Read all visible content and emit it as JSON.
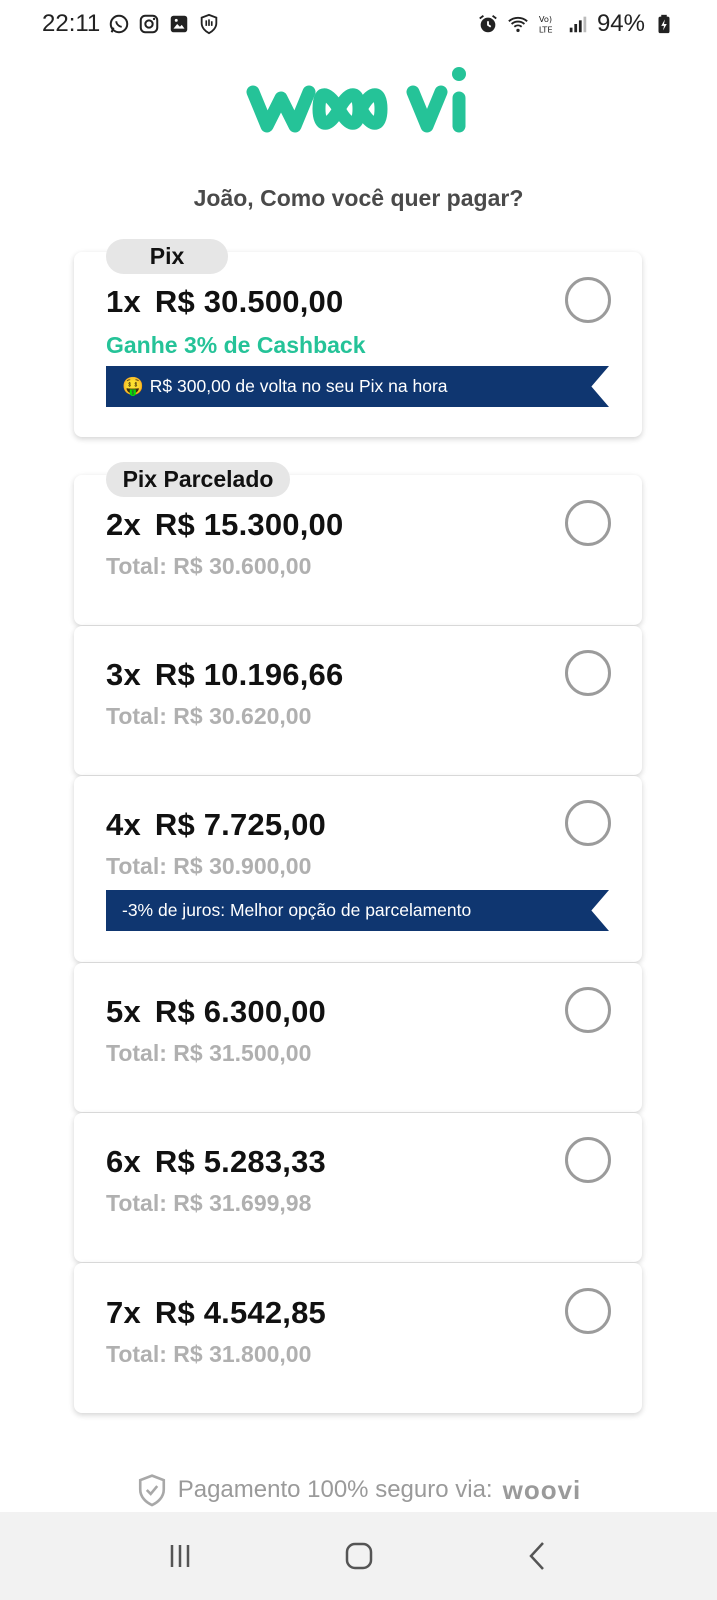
{
  "status": {
    "time": "22:11",
    "battery": "94%",
    "left_icons": [
      "whatsapp-icon",
      "instagram-icon",
      "gallery-icon",
      "shield-hand-icon"
    ],
    "right_icons": [
      "alarm-icon",
      "wifi-icon",
      "volte-icon",
      "signal-icon",
      "battery-icon"
    ]
  },
  "brand": {
    "name": "woovi",
    "color": "#25c398"
  },
  "prompt": "João, Como você quer pagar?",
  "pix": {
    "chip_label": "Pix",
    "multiplier": "1x",
    "amount": "R$ 30.500,00",
    "cashback": "Ganhe 3% de Cashback",
    "ribbon_emoji": "🤑",
    "ribbon_text": "R$ 300,00 de volta no seu Pix na hora"
  },
  "installments": {
    "chip_label": "Pix Parcelado",
    "options": [
      {
        "multiplier": "2x",
        "amount": "R$ 15.300,00",
        "total": "Total: R$ 30.600,00"
      },
      {
        "multiplier": "3x",
        "amount": "R$ 10.196,66",
        "total": "Total: R$ 30.620,00"
      },
      {
        "multiplier": "4x",
        "amount": "R$ 7.725,00",
        "total": "Total: R$ 30.900,00",
        "ribbon_text": "-3% de juros: Melhor opção de parcelamento"
      },
      {
        "multiplier": "5x",
        "amount": "R$ 6.300,00",
        "total": "Total: R$ 31.500,00"
      },
      {
        "multiplier": "6x",
        "amount": "R$ 5.283,33",
        "total": "Total: R$ 31.699,98"
      },
      {
        "multiplier": "7x",
        "amount": "R$ 4.542,85",
        "total": "Total: R$ 31.800,00"
      }
    ]
  },
  "footer": {
    "secure_text": "Pagamento 100% seguro via:",
    "brand": "woovi"
  },
  "colors": {
    "accent": "#25c398",
    "ribbon": "#0f3670",
    "muted": "#b0b0b0"
  }
}
